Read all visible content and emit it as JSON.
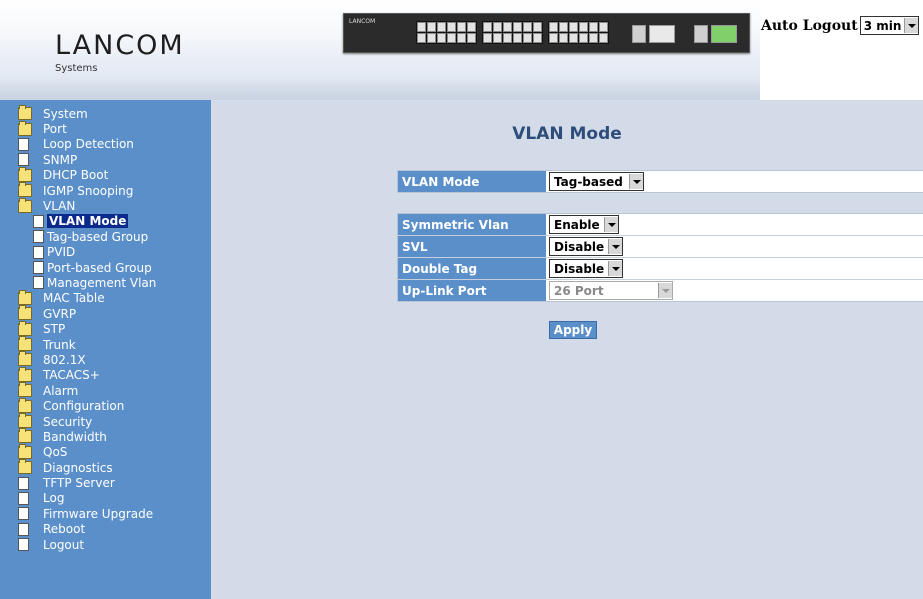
{
  "header": {
    "logo": "LANCOM",
    "logo_sub": "Systems",
    "auto_logout_label": "Auto Logout",
    "auto_logout_value": "3 min"
  },
  "sidebar": {
    "items": [
      {
        "label": "System",
        "icon": "folder-icon"
      },
      {
        "label": "Port",
        "icon": "folder-icon"
      },
      {
        "label": "Loop Detection",
        "icon": "page-icon"
      },
      {
        "label": "SNMP",
        "icon": "page-icon"
      },
      {
        "label": "DHCP Boot",
        "icon": "folder-icon"
      },
      {
        "label": "IGMP Snooping",
        "icon": "folder-icon"
      },
      {
        "label": "VLAN",
        "icon": "folder-open-icon"
      },
      {
        "label": "VLAN Mode",
        "icon": "page-icon",
        "sub": true,
        "active": true
      },
      {
        "label": "Tag-based Group",
        "icon": "page-icon",
        "sub": true
      },
      {
        "label": "PVID",
        "icon": "page-icon",
        "sub": true
      },
      {
        "label": "Port-based Group",
        "icon": "page-icon",
        "sub": true
      },
      {
        "label": "Management Vlan",
        "icon": "page-icon",
        "sub": true
      },
      {
        "label": "MAC Table",
        "icon": "folder-icon"
      },
      {
        "label": "GVRP",
        "icon": "folder-icon"
      },
      {
        "label": "STP",
        "icon": "folder-icon"
      },
      {
        "label": "Trunk",
        "icon": "folder-icon"
      },
      {
        "label": "802.1X",
        "icon": "folder-icon"
      },
      {
        "label": "TACACS+",
        "icon": "folder-icon"
      },
      {
        "label": "Alarm",
        "icon": "folder-icon"
      },
      {
        "label": "Configuration",
        "icon": "folder-icon"
      },
      {
        "label": "Security",
        "icon": "folder-icon"
      },
      {
        "label": "Bandwidth",
        "icon": "folder-icon"
      },
      {
        "label": "QoS",
        "icon": "folder-icon"
      },
      {
        "label": "Diagnostics",
        "icon": "folder-icon"
      },
      {
        "label": "TFTP Server",
        "icon": "page-icon"
      },
      {
        "label": "Log",
        "icon": "page-icon"
      },
      {
        "label": "Firmware Upgrade",
        "icon": "page-icon"
      },
      {
        "label": "Reboot",
        "icon": "page-icon"
      },
      {
        "label": "Logout",
        "icon": "page-icon"
      }
    ]
  },
  "main": {
    "title": "VLAN Mode",
    "vlan_mode": {
      "label": "VLAN Mode",
      "value": "Tag-based"
    },
    "settings": [
      {
        "label": "Symmetric Vlan",
        "value": "Enable",
        "disabled": false
      },
      {
        "label": "SVL",
        "value": "Disable",
        "disabled": false
      },
      {
        "label": "Double Tag",
        "value": "Disable",
        "disabled": false
      },
      {
        "label": "Up-Link Port",
        "value": "26 Port",
        "disabled": true
      }
    ],
    "apply_label": "Apply"
  },
  "colors": {
    "sidebar_bg": "#5b8fca",
    "main_bg": "#d3dbe9",
    "title": "#2f4d7a",
    "active_item": "#0b2a8c"
  }
}
